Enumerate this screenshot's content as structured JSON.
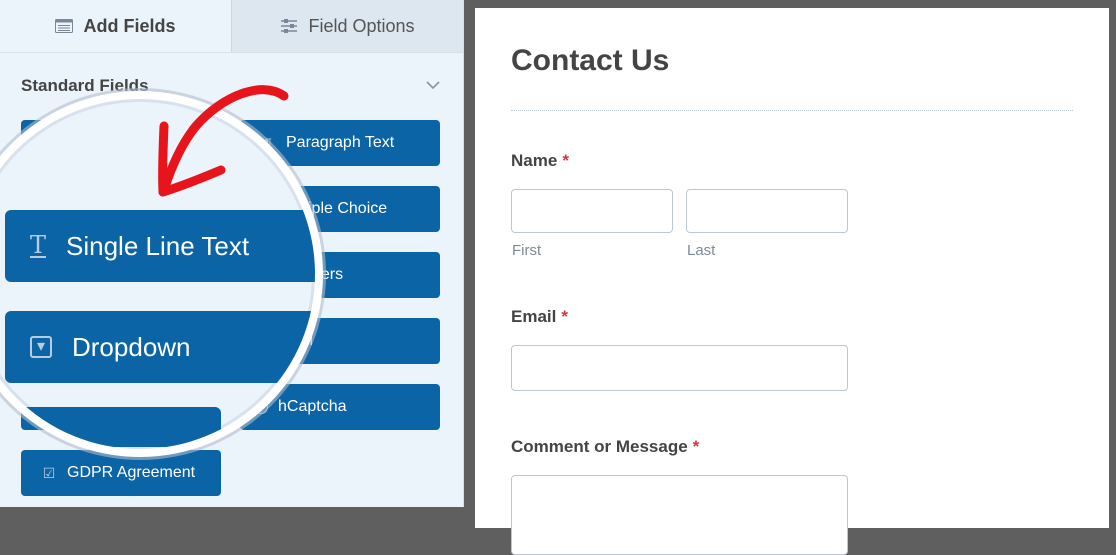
{
  "sidebar": {
    "tabs": [
      {
        "label": "Add Fields",
        "icon": "list-table-icon",
        "active": true
      },
      {
        "label": "Field Options",
        "icon": "sliders-icon",
        "active": false
      }
    ],
    "section_title": "Standard Fields",
    "fields_right": [
      {
        "label": "Paragraph Text",
        "icon": "paragraph-icon"
      },
      {
        "label": "ltiple Choice",
        "icon": "radio-icon"
      },
      {
        "label": "bers",
        "icon": "hash-icon"
      },
      {
        "label": "ail",
        "icon": "envelope-icon"
      },
      {
        "label": "hCaptcha",
        "icon": "question-circle-icon",
        "glyph": "?"
      }
    ],
    "fields_left": [
      {
        "label": "GDPR Agreement",
        "icon": "checkbox-icon",
        "glyph": "☑"
      }
    ],
    "magnified": [
      {
        "label": "Single Line Text",
        "icon": "text-cursor-icon",
        "glyph": "T"
      },
      {
        "label": "Dropdown",
        "icon": "dropdown-icon",
        "glyph": "▾"
      }
    ],
    "annotation_color": "#e8141c"
  },
  "form": {
    "title": "Contact Us",
    "required_mark": "*",
    "fields": {
      "name": {
        "label": "Name",
        "first_sublabel": "First",
        "last_sublabel": "Last",
        "first_value": "",
        "last_value": ""
      },
      "email": {
        "label": "Email",
        "value": ""
      },
      "message": {
        "label": "Comment or Message",
        "value": ""
      }
    }
  },
  "colors": {
    "button_blue": "#0b64a6",
    "required_red": "#d63638",
    "panel_bg": "#ebf3fb"
  }
}
